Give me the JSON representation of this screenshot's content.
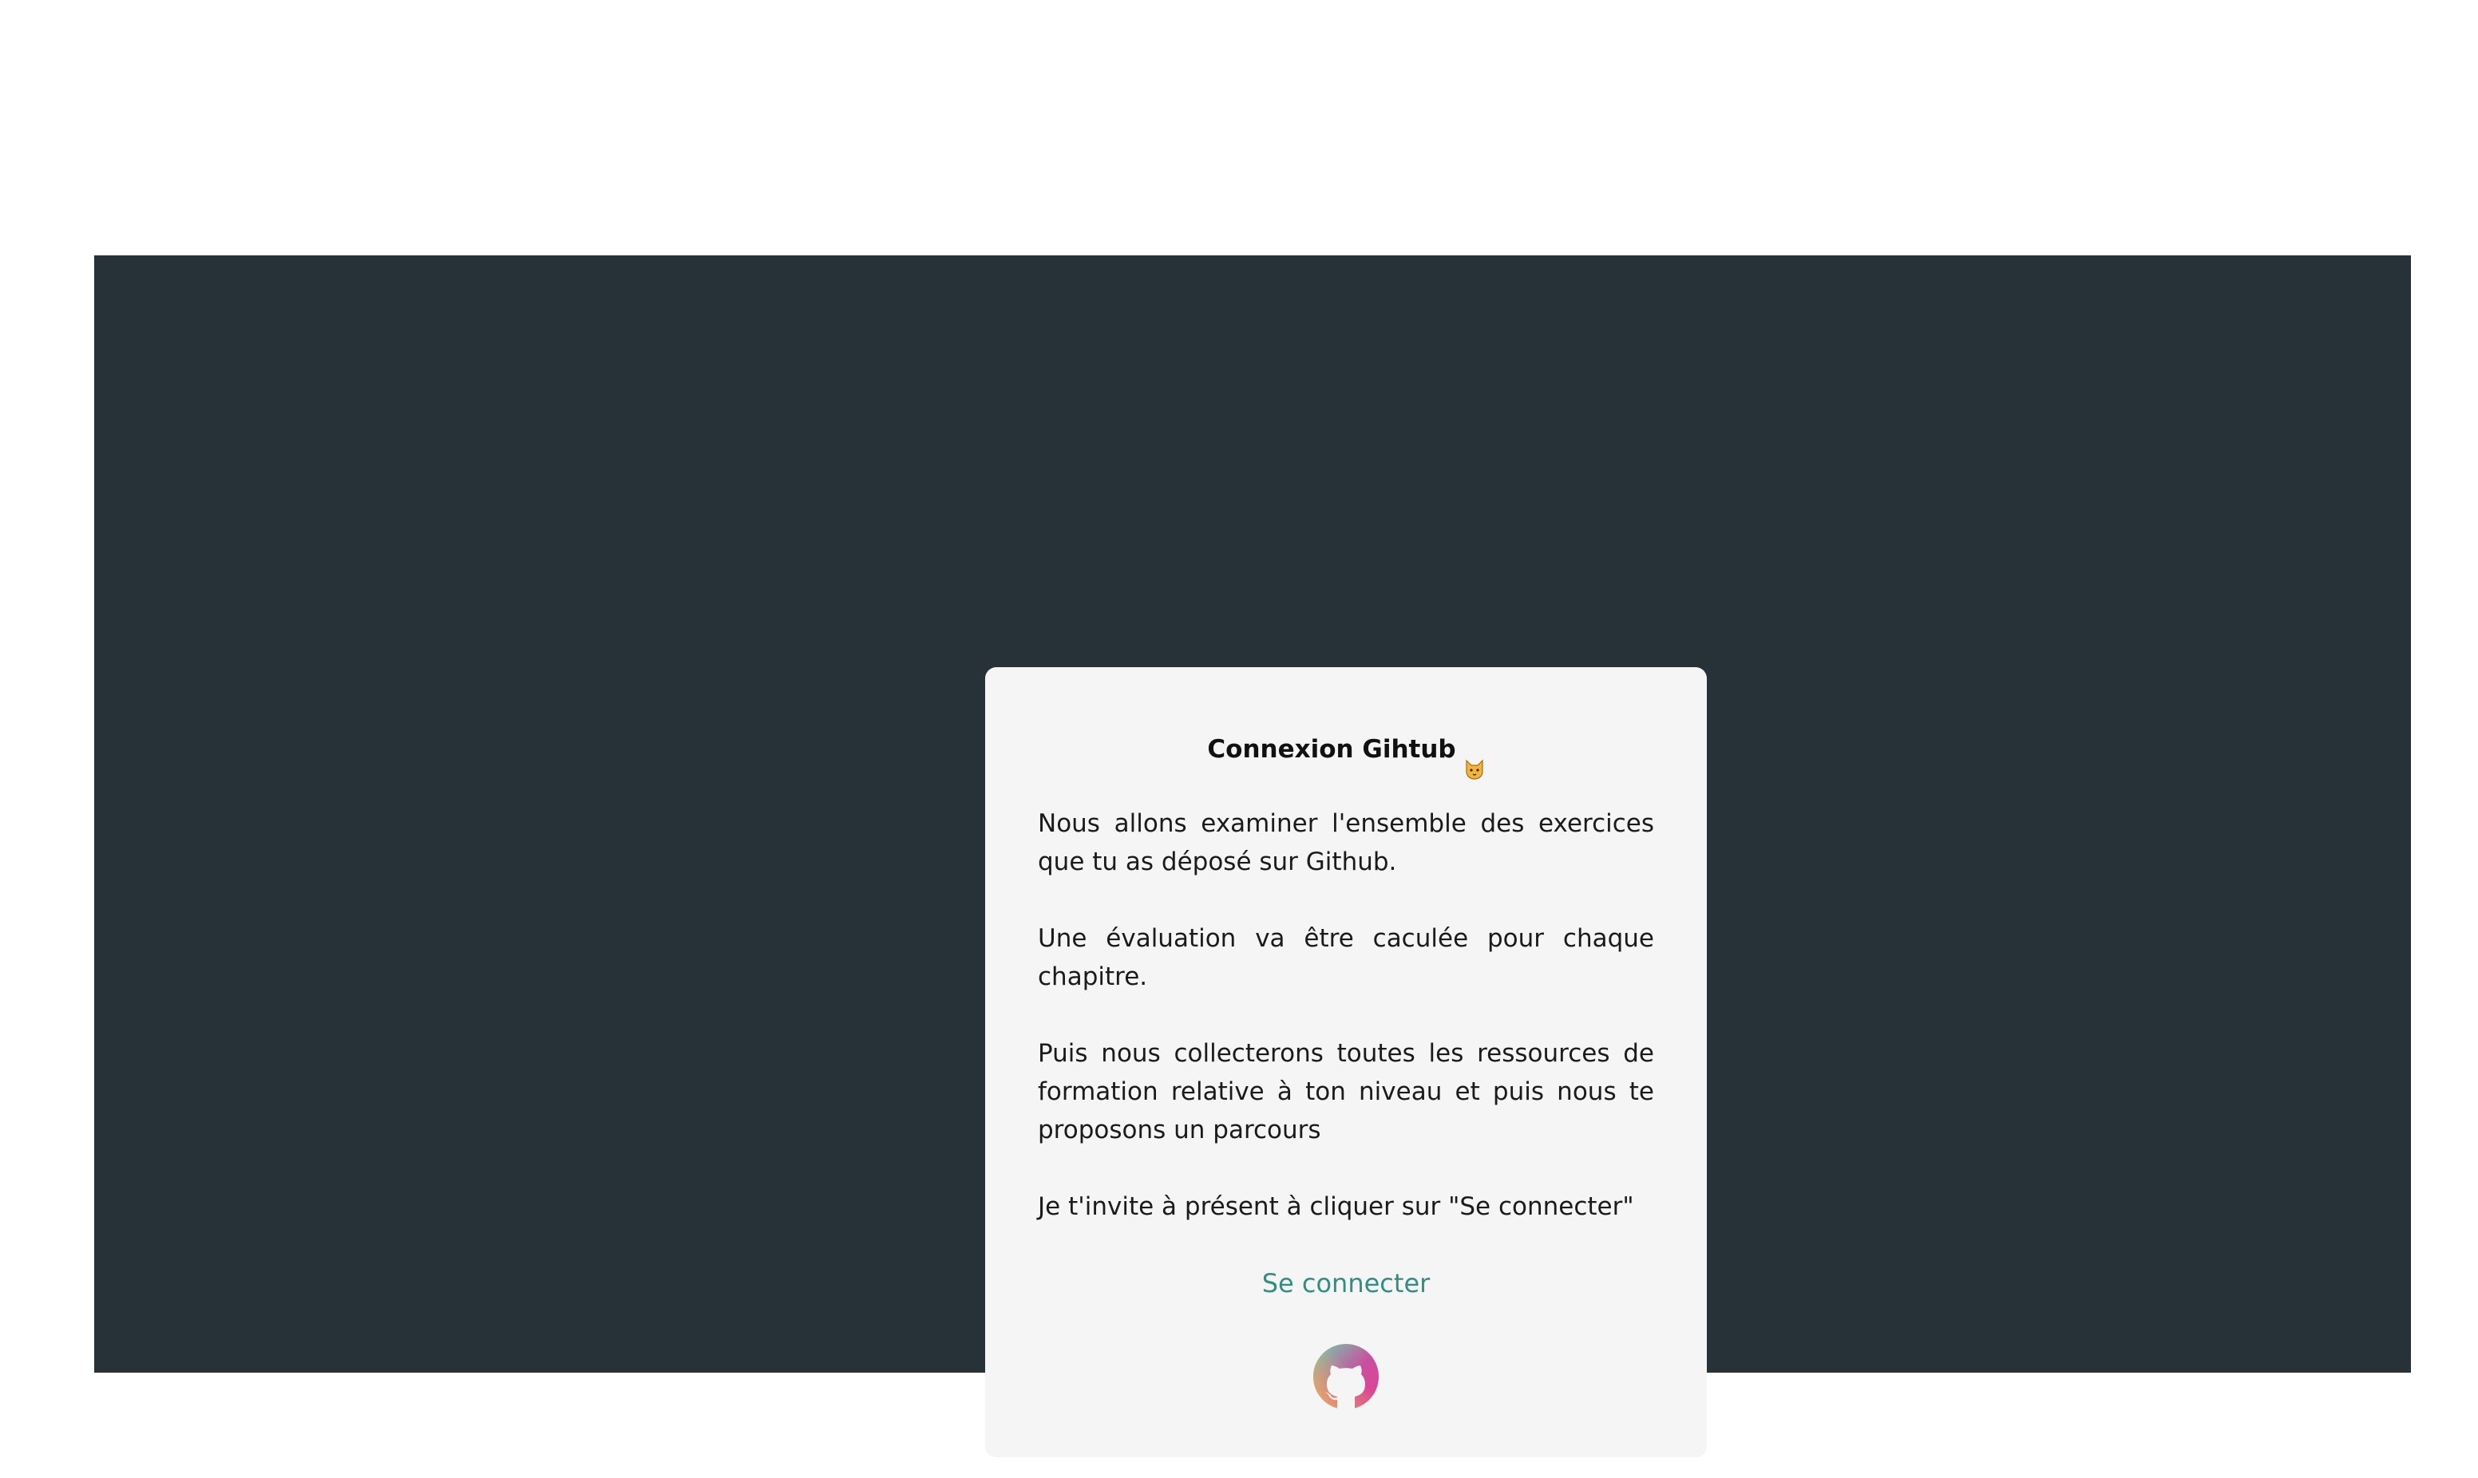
{
  "card": {
    "title": "Connexion Gihtub",
    "title_icon": "cat-face-icon",
    "paragraphs": [
      "Nous allons examiner l'ensemble des exercices que tu as déposé sur Github.",
      "Une évaluation va être caculée pour chaque chapitre.",
      "Puis nous collecterons toutes les ressources de formation relative à ton niveau et puis nous te proposons un parcours",
      "Je t'invite à présent à cliquer sur \"Se connecter\""
    ],
    "connect_label": "Se connecter",
    "logo_icon": "github-icon"
  },
  "colors": {
    "backdrop": "#263238",
    "card": "#f5f5f5",
    "link": "#2f8f83",
    "logo_gradient": [
      "#6dd5a8",
      "#e83e8c",
      "#f0b35c"
    ]
  }
}
